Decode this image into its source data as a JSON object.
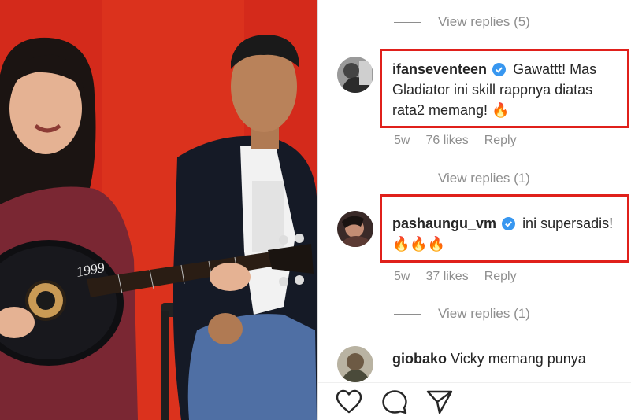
{
  "video": {
    "guitar_text": "1999"
  },
  "comments_panel": {
    "replies_top": "View replies (5)",
    "comments": [
      {
        "username": "ifanseventeen",
        "text": "Gawattt! Mas Gladiator ini skill rappnya diatas rata2 memang! 🔥",
        "time": "5w",
        "likes": "76 likes",
        "reply": "Reply",
        "view_replies": "View replies (1)"
      },
      {
        "username": "pashaungu_vm",
        "text": "ini supersadis! 🔥🔥🔥",
        "time": "5w",
        "likes": "37 likes",
        "reply": "Reply",
        "view_replies": "View replies (1)"
      },
      {
        "username": "giobako",
        "text": "Vicky memang punya"
      }
    ]
  },
  "colors": {
    "highlight": "#e0201b",
    "verified": "#3897f0",
    "muted": "#8e8e8e",
    "background_red": "#d8281a"
  },
  "actions": {
    "icons": [
      "heart-icon",
      "comment-icon",
      "share-icon"
    ]
  }
}
